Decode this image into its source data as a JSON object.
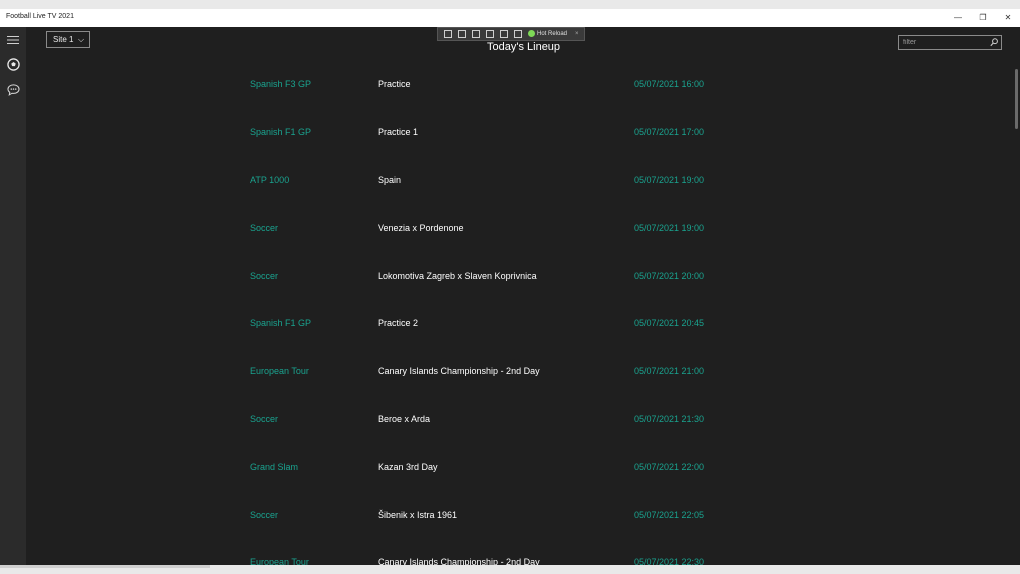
{
  "window": {
    "title": "Football Live TV 2021",
    "controls": {
      "minimize": "—",
      "maximize": "❐",
      "close": "✕"
    }
  },
  "rail": {
    "items": [
      {
        "name": "menu",
        "icon": "hamburger-icon"
      },
      {
        "name": "football",
        "icon": "soccer-ball-icon"
      },
      {
        "name": "chat",
        "icon": "chat-bubble-icon"
      }
    ]
  },
  "header": {
    "site_select": {
      "value": "Site 1",
      "chevron": "⌵"
    },
    "title": "Today's Lineup",
    "filter": {
      "placeholder": "filter",
      "value": ""
    }
  },
  "debug_toolbar": {
    "hot_reload_label": "Hot Reload",
    "close": "×"
  },
  "colors": {
    "accent": "#1aa38f",
    "background": "#1f1f1f",
    "rail": "#2b2b2b",
    "hot_reload_dot": "#7ed957"
  },
  "lineup": [
    {
      "sport": "Spanish F3 GP",
      "event": "Practice",
      "datetime": "05/07/2021 16:00"
    },
    {
      "sport": "Spanish F1 GP",
      "event": "Practice 1",
      "datetime": "05/07/2021 17:00"
    },
    {
      "sport": "ATP 1000",
      "event": "Spain",
      "datetime": "05/07/2021 19:00"
    },
    {
      "sport": "Soccer",
      "event": "Venezia x Pordenone",
      "datetime": "05/07/2021 19:00"
    },
    {
      "sport": "Soccer",
      "event": "Lokomotiva Zagreb x Slaven Koprivnica",
      "datetime": "05/07/2021 20:00"
    },
    {
      "sport": "Spanish F1 GP",
      "event": "Practice 2",
      "datetime": "05/07/2021 20:45"
    },
    {
      "sport": "European Tour",
      "event": "Canary Islands Championship - 2nd Day",
      "datetime": "05/07/2021 21:00"
    },
    {
      "sport": "Soccer",
      "event": "Beroe x Arda",
      "datetime": "05/07/2021 21:30"
    },
    {
      "sport": "Grand Slam",
      "event": "Kazan 3rd Day",
      "datetime": "05/07/2021 22:00"
    },
    {
      "sport": "Soccer",
      "event": "Šibenik x Istra 1961",
      "datetime": "05/07/2021 22:05"
    },
    {
      "sport": "European Tour",
      "event": "Canary Islands Championship - 2nd Day",
      "datetime": "05/07/2021 22:30"
    }
  ]
}
